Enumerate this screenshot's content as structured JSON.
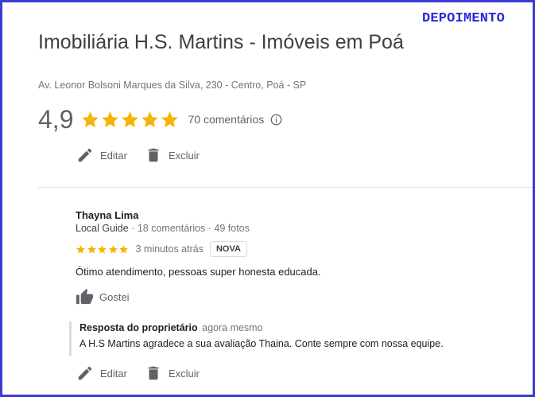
{
  "stamp": "DEPOIMENTO",
  "business": {
    "name": "Imobiliária H.S. Martins - Imóveis em Poá",
    "address": "Av. Leonor Bolsoni Marques da Silva, 230 - Centro, Poá - SP",
    "rating": "4,9",
    "stars": 5,
    "review_count": "70 comentários"
  },
  "actions": {
    "edit": "Editar",
    "delete": "Excluir"
  },
  "review": {
    "author": "Thayna Lima",
    "author_badge": "Local Guide",
    "author_stats": "· 18 comentários · 49 fotos",
    "stars": 5,
    "time": "3 minutos atrás",
    "new_label": "NOVA",
    "text": "Ótimo atendimento, pessoas super honesta educada.",
    "like_label": "Gostei"
  },
  "owner_response": {
    "heading": "Resposta do proprietário",
    "time": "agora mesmo",
    "text": "A H.S Martins agradece a sua avaliação Thaina. Conte sempre com nossa equipe."
  },
  "colors": {
    "star": "#f5b400",
    "frame": "#3b3bd6",
    "stamp": "#2a2ad8"
  },
  "icons": [
    "pencil-icon",
    "trash-icon",
    "info-icon",
    "thumbs-up-icon",
    "star-icon"
  ]
}
